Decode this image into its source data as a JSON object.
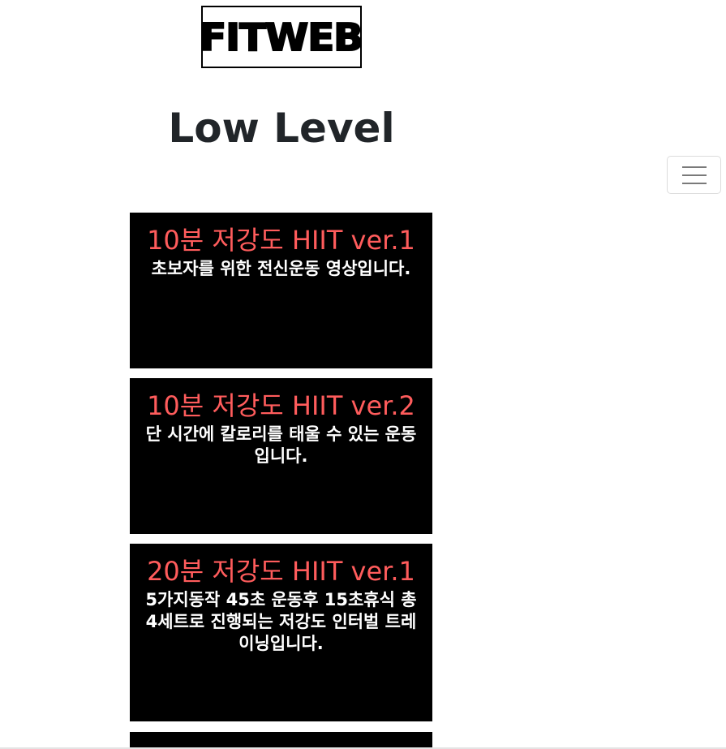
{
  "logo": {
    "text": "FITWEB"
  },
  "page": {
    "title": "Low Level"
  },
  "navbar": {
    "toggle_icon": "hamburger-menu-icon"
  },
  "cards": [
    {
      "title": "10분 저강도 HIIT ver.1",
      "description": "초보자를 위한 전신운동 영상입니다."
    },
    {
      "title": "10분 저강도 HIIT ver.2",
      "description": "단 시간에 칼로리를 태울 수 있는 운동입니다."
    },
    {
      "title": "20분 저강도 HIIT ver.1",
      "description": "5가지동작 45초 운동후 15초휴식 총 4세트로 진행되는 저강도 인터벌 트레이닝입니다."
    }
  ],
  "colors": {
    "card_background": "#000000",
    "card_title": "#ff5c5c",
    "card_text": "#ffffff",
    "page_title": "#212529"
  }
}
